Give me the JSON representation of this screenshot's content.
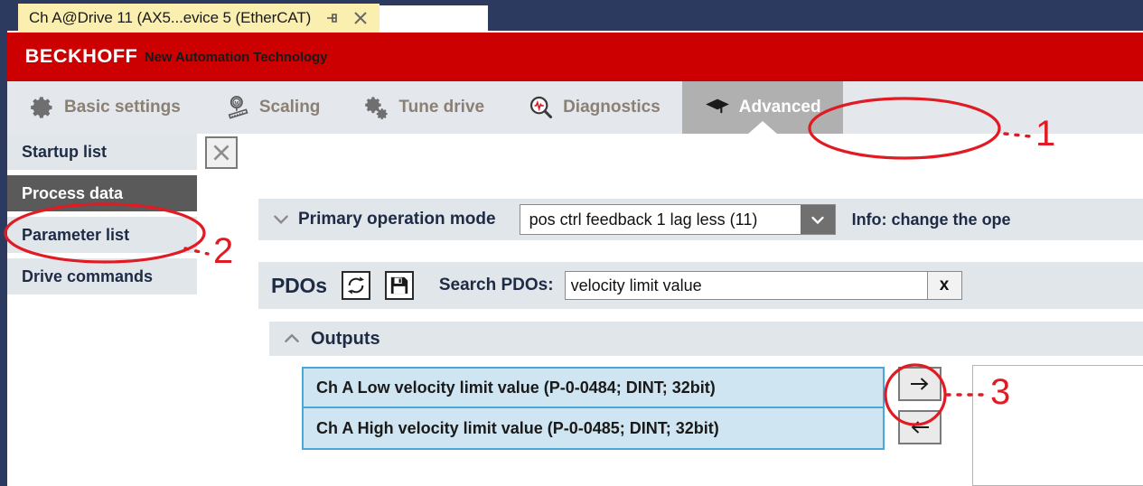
{
  "window": {
    "tab_title": "Ch A@Drive 11 (AX5...evice 5 (EtherCAT)",
    "pin_icon": "pin-icon",
    "close_icon": "close-icon"
  },
  "brand": {
    "logo": "BECKHOFF",
    "tagline": "New Automation Technology",
    "color": "#cc0000"
  },
  "toolbar": {
    "tabs": [
      {
        "label": "Basic settings",
        "icon": "gear-icon",
        "active": false
      },
      {
        "label": "Scaling",
        "icon": "motor-scale-icon",
        "active": false
      },
      {
        "label": "Tune drive",
        "icon": "gears-icon",
        "active": false
      },
      {
        "label": "Diagnostics",
        "icon": "magnifier-pulse-icon",
        "active": false
      },
      {
        "label": "Advanced",
        "icon": "graduation-cap-icon",
        "active": true
      }
    ]
  },
  "sidebar": {
    "items": [
      {
        "label": "Startup list",
        "active": false
      },
      {
        "label": "Process data",
        "active": true
      },
      {
        "label": "Parameter list",
        "active": false
      },
      {
        "label": "Drive commands",
        "active": false
      }
    ],
    "close_icon": "close-icon"
  },
  "operation_mode": {
    "collapse_icon": "chevron-down-icon",
    "label": "Primary operation mode",
    "value": "pos ctrl feedback 1 lag less (11)",
    "dropdown_icon": "chevron-down-icon",
    "info": "Info: change the ope"
  },
  "pdos": {
    "label": "PDOs",
    "refresh_icon": "refresh-icon",
    "save_icon": "save-icon",
    "search_label": "Search PDOs:",
    "search_value": "velocity limit value",
    "search_placeholder": "Search PDOs",
    "clear_label": "x"
  },
  "outputs": {
    "collapse_icon": "chevron-up-icon",
    "label": "Outputs",
    "rows": [
      "Ch A Low velocity limit value (P-0-0484; DINT; 32bit)",
      "Ch A High velocity limit value (P-0-0485; DINT; 32bit)"
    ]
  },
  "transfer": {
    "right_icon": "arrow-right-icon",
    "left_icon": "arrow-left-icon"
  },
  "annotations": {
    "color": "#e01b24",
    "markers": [
      {
        "number": "1",
        "target": "advanced-tab"
      },
      {
        "number": "2",
        "target": "sidebar-item-process-data"
      },
      {
        "number": "3",
        "target": "move-right-button"
      }
    ]
  }
}
